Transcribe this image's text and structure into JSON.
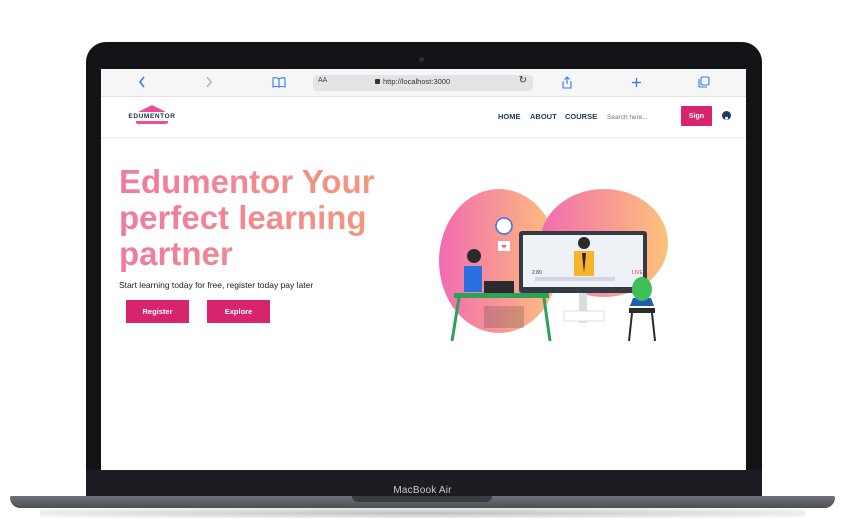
{
  "device": {
    "bezel_label": "MacBook Air"
  },
  "browser": {
    "aa": "AA",
    "url": "http://localhost:3000",
    "buttons": {
      "back": "chevron-left",
      "forward": "chevron-right",
      "bookmarks": "book",
      "reload": "reload",
      "share": "share",
      "new_tab": "plus",
      "tabs": "tabs"
    }
  },
  "nav": {
    "logo_text": "EDUMENTOR",
    "items": [
      "HOME",
      "ABOUT",
      "COURSE"
    ],
    "search_placeholder": "Search here...",
    "sign_label": "Sign"
  },
  "hero": {
    "title": "Edumentor Your perfect learning partner",
    "subtitle": "Start learning today for free, register today pay later",
    "register_label": "Register",
    "explore_label": "Explore"
  },
  "illustration": {
    "live_badge": "LIVE",
    "viewer_count": "2.80"
  },
  "colors": {
    "accent": "#d6246d",
    "title_gradient_start": "#f07aa0",
    "title_gradient_end": "#f39c7a",
    "nav_text": "#1f3a5f"
  }
}
